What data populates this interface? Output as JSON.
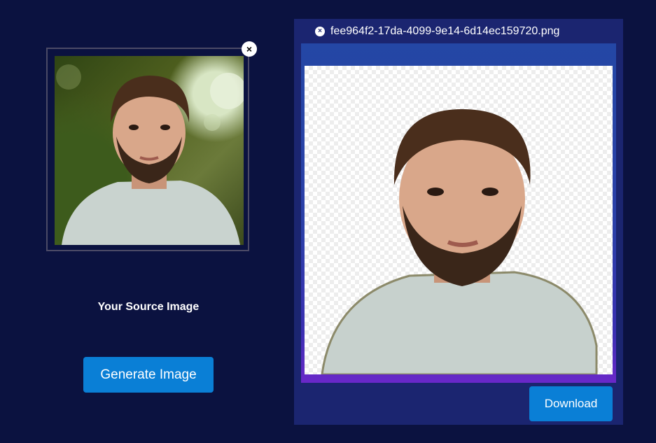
{
  "source": {
    "label": "Your Source Image",
    "close_glyph": "×",
    "image_description": "portrait-photo-man-beard"
  },
  "actions": {
    "generate_label": "Generate Image",
    "download_label": "Download"
  },
  "result": {
    "file_name": "fee964f2-17da-4099-9e14-6d14ec159720.png",
    "close_glyph": "×",
    "image_description": "portrait-cutout-transparent-background"
  },
  "colors": {
    "page_background": "#0b1240",
    "panel_background": "#1b2570",
    "button_blue": "#0a7fd6",
    "preview_gradient_end": "#6a28c9"
  },
  "icons": {
    "remove_source": "close-icon",
    "remove_file": "close-icon"
  }
}
